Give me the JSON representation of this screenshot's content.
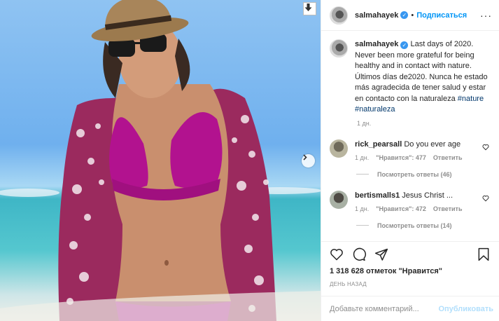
{
  "post": {
    "username": "salmahayek",
    "follow_label": "Подписаться",
    "caption_text": "Last days of 2020. Never been more grateful for being healthy and in contact with nature. Últimos días de2020. Nunca he estado más agradecida de tener salud y estar en contacto con la naturaleza",
    "hashtags": [
      "#nature",
      "#naturaleza"
    ],
    "caption_time": "1 дн.",
    "likes": "1 318 628 отметок \"Нравится\"",
    "date": "ДЕНЬ НАЗАД",
    "comment_placeholder": "Добавьте комментарий...",
    "publish_label": "Опубликовать"
  },
  "comments": [
    {
      "username": "rick_pearsall",
      "text": "Do you ever age",
      "time": "1 дн.",
      "likes": "\"Нравится\": 477",
      "reply": "Ответить",
      "replies": "Посмотреть ответы (46)"
    },
    {
      "username": "bertismalls1",
      "text": "Jesus Christ ...",
      "time": "1 дн.",
      "likes": "\"Нравится\": 472",
      "reply": "Ответить",
      "replies": "Посмотреть ответы (14)"
    }
  ],
  "icons": [
    "download-icon",
    "chevron-right-icon",
    "verified-icon",
    "heart-icon",
    "comment-icon",
    "share-icon",
    "bookmark-icon"
  ],
  "colors": {
    "accent": "#0095f6",
    "verified": "#3897f0",
    "muted": "#8e8e8e",
    "publish_disabled": "#b2dffc"
  }
}
